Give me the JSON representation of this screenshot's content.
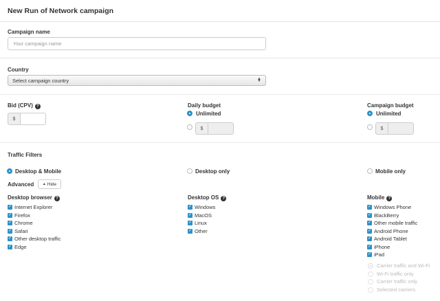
{
  "title": "New Run of Network campaign",
  "campaign_name": {
    "label": "Campaign name",
    "placeholder": "Your campaign name"
  },
  "country": {
    "label": "Country",
    "selected": "Select campaign country"
  },
  "bid": {
    "label": "Bid (CPV)",
    "currency": "$"
  },
  "daily_budget": {
    "label": "Daily budget",
    "unlimited": "Unlimited",
    "currency": "$"
  },
  "campaign_budget": {
    "label": "Campaign budget",
    "unlimited": "Unlimited",
    "currency": "$"
  },
  "traffic_filters": {
    "label": "Traffic Filters",
    "options": [
      "Desktop & Mobile",
      "Desktop only",
      "Mobile only"
    ],
    "advanced": "Advanced",
    "hide_button": "Hide"
  },
  "desktop_browser": {
    "label": "Desktop browser",
    "items": [
      "Internet Explorer",
      "Firefox",
      "Chrome",
      "Safari",
      "Other desktop traffic",
      "Edge"
    ]
  },
  "desktop_os": {
    "label": "Desktop OS",
    "items": [
      "Windows",
      "MacOS",
      "Linux",
      "Other"
    ]
  },
  "mobile": {
    "label": "Mobile",
    "items": [
      "Windows Phone",
      "BlackBerry",
      "Other mobile traffic",
      "Android Phone",
      "Android Tablet",
      "iPhone",
      "iPad"
    ],
    "carrier_options": [
      "Carrier traffic and Wi-Fi",
      "Wi-Fi traffic only",
      "Carrier traffic only",
      "Selected carriers"
    ]
  },
  "colors": {
    "accent": "#2d91c7",
    "divider": "#e7e7e7"
  }
}
